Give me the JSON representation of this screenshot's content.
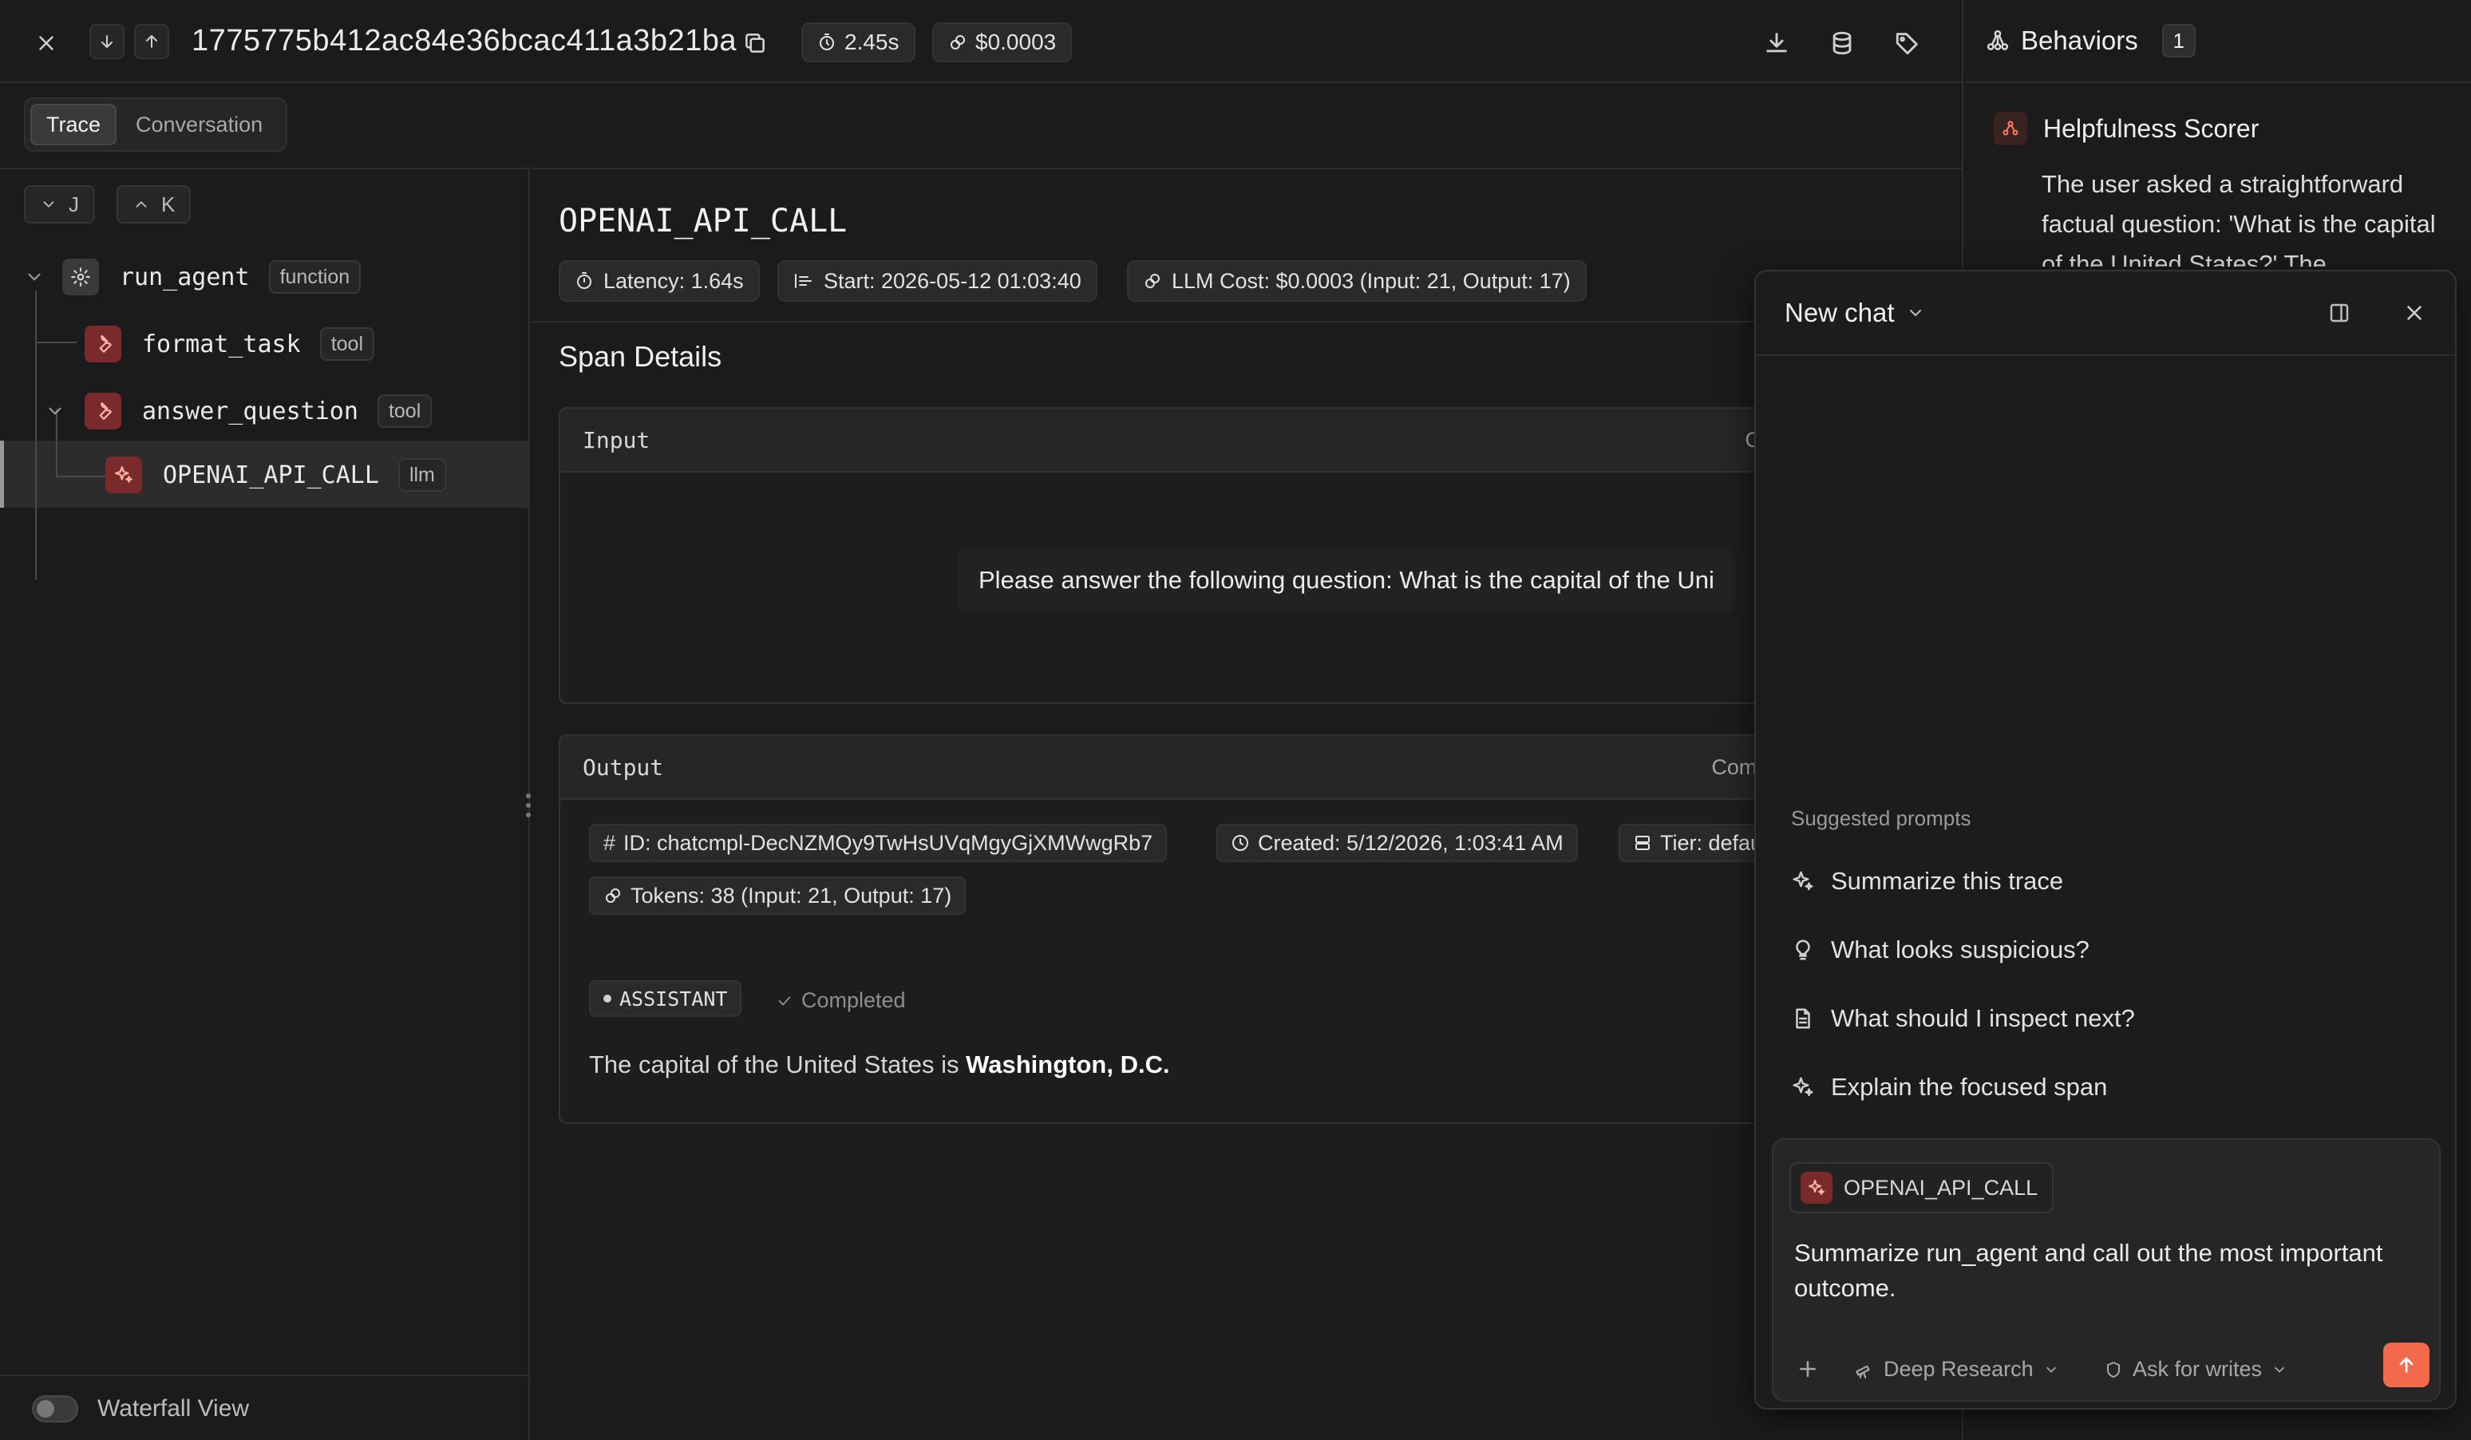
{
  "topbar": {
    "trace_id": "1775775b412ac84e36bcac411a3b21ba",
    "duration": "2.45s",
    "cost": "$0.0003"
  },
  "tabs": [
    {
      "label": "Trace",
      "active": true
    },
    {
      "label": "Conversation",
      "active": false
    }
  ],
  "tree": {
    "nav_down_key": "J",
    "nav_up_key": "K",
    "nodes": [
      {
        "name": "run_agent",
        "type": "function"
      },
      {
        "name": "format_task",
        "type": "tool"
      },
      {
        "name": "answer_question",
        "type": "tool"
      },
      {
        "name": "OPENAI_API_CALL",
        "type": "llm"
      }
    ],
    "waterfall_label": "Waterfall View"
  },
  "span": {
    "title": "OPENAI_API_CALL",
    "latency": "Latency: 1.64s",
    "start": "Start: 2026-05-12 01:03:40",
    "llm_cost": "LLM Cost: $0.0003 (Input: 21, Output: 17)",
    "details_title": "Span Details",
    "input": {
      "label": "Input",
      "kind": "Chat Conversation",
      "message": "Please answer the following question: What is the capital of the Uni"
    },
    "output": {
      "label": "Output",
      "kind": "Completion Response",
      "id": "ID: chatcmpl-DecNZMQy9TwHsUVqMgyGjXMWwgRb7",
      "created": "Created: 5/12/2026, 1:03:41 AM",
      "tier": "Tier: defau",
      "tokens": "Tokens: 38 (Input: 21, Output: 17)",
      "role": "ASSISTANT",
      "status": "Completed",
      "answer_prefix": "The capital of the United States is ",
      "answer_bold": "Washington, D.C."
    }
  },
  "behaviors": {
    "title": "Behaviors",
    "count": "1",
    "scorer_name": "Helpfulness Scorer",
    "scorer_text": "The user asked a straightforward factual question: 'What is the capital of the United States?' The"
  },
  "chat": {
    "title": "New chat",
    "suggested_label": "Suggested prompts",
    "prompts": [
      {
        "label": "Summarize this trace",
        "icon": "sparkles-icon"
      },
      {
        "label": "What looks suspicious?",
        "icon": "lightbulb-icon"
      },
      {
        "label": "What should I inspect next?",
        "icon": "document-icon"
      },
      {
        "label": "Explain the focused span",
        "icon": "sparkles-icon"
      }
    ],
    "context_chip": "OPENAI_API_CALL",
    "input_text": "Summarize run_agent and call out the most important outcome.",
    "mode": "Deep Research",
    "permission": "Ask for writes",
    "accent": "#f26a4b"
  }
}
